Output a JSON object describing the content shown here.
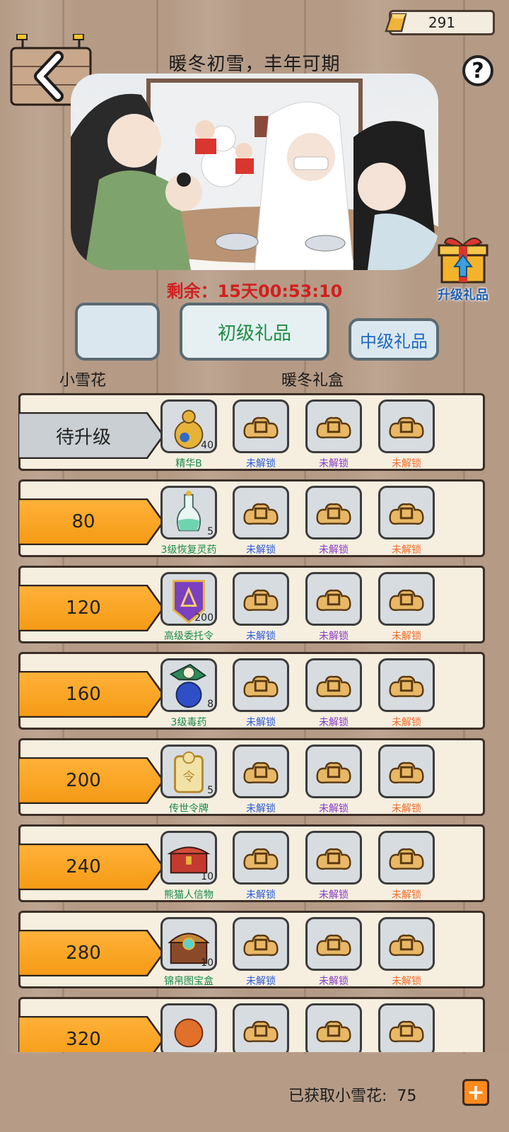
{
  "currency": {
    "icon": "gold-bar-icon",
    "amount": "291"
  },
  "header": {
    "title": "暖冬初雪，丰年可期",
    "help": "?"
  },
  "countdown": "剩余：15天00:53:10",
  "upgrade_gift": {
    "label": "升级礼品"
  },
  "tabs": [
    {
      "label": ""
    },
    {
      "label": "初级礼品"
    },
    {
      "label": "中级礼品"
    }
  ],
  "columns": {
    "left": "小雪花",
    "right": "暖冬礼盒"
  },
  "rows": [
    {
      "tier": "待升级",
      "reward": {
        "name": "精华B",
        "qty": "40",
        "icon": "gourd-icon"
      },
      "locked": [
        "未解锁",
        "未解锁",
        "未解锁"
      ]
    },
    {
      "tier": "80",
      "reward": {
        "name": "3级恢复灵药",
        "qty": "5",
        "icon": "potion-bottle-icon"
      },
      "locked": [
        "未解锁",
        "未解锁",
        "未解锁"
      ]
    },
    {
      "tier": "120",
      "reward": {
        "name": "高级委托令",
        "qty": "200",
        "icon": "purple-token-icon"
      },
      "locked": [
        "未解锁",
        "未解锁",
        "未解锁"
      ]
    },
    {
      "tier": "160",
      "reward": {
        "name": "3级毒药",
        "qty": "8",
        "icon": "poison-icon"
      },
      "locked": [
        "未解锁",
        "未解锁",
        "未解锁"
      ]
    },
    {
      "tier": "200",
      "reward": {
        "name": "传世令牌",
        "qty": "5",
        "icon": "token-plaque-icon"
      },
      "locked": [
        "未解锁",
        "未解锁",
        "未解锁"
      ]
    },
    {
      "tier": "240",
      "reward": {
        "name": "熊猫人信物",
        "qty": "10",
        "icon": "red-chest-icon"
      },
      "locked": [
        "未解锁",
        "未解锁",
        "未解锁"
      ]
    },
    {
      "tier": "280",
      "reward": {
        "name": "锦帛图宝盒",
        "qty": "10",
        "icon": "treasure-chest-icon"
      },
      "locked": [
        "未解锁",
        "未解锁",
        "未解锁"
      ]
    },
    {
      "tier": "320",
      "reward": {
        "name": "",
        "qty": "",
        "icon": "orange-item-icon"
      },
      "locked": [
        "",
        "",
        ""
      ]
    }
  ],
  "footer": {
    "obtained_label": "已获取小雪花:",
    "obtained_value": "75",
    "plus": "+"
  }
}
